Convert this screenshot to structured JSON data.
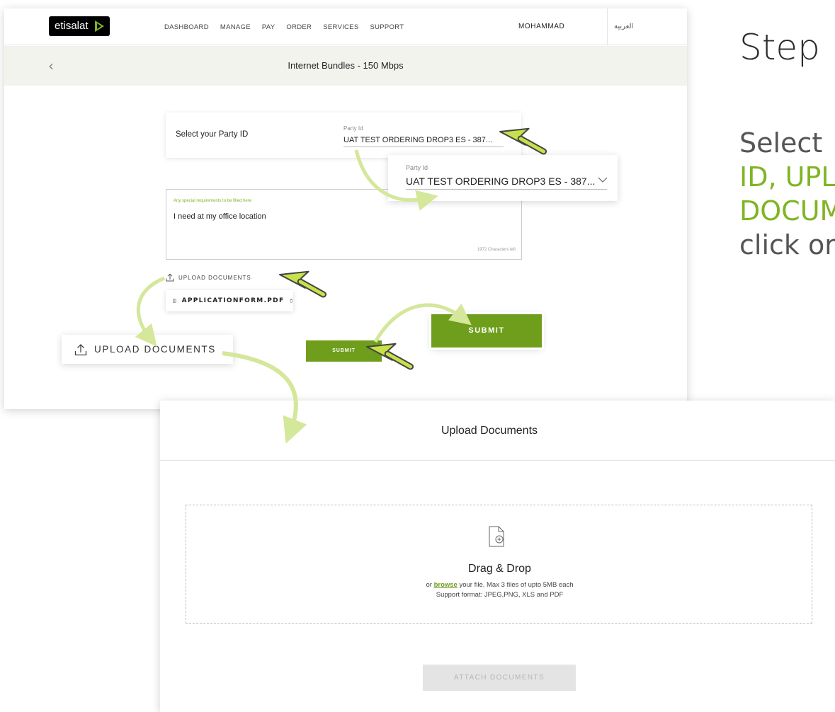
{
  "header": {
    "logo_text": "etisalat",
    "nav": [
      "DASHBOARD",
      "MANAGE",
      "PAY",
      "ORDER",
      "SERVICES",
      "SUPPORT"
    ],
    "user": "MOHAMMAD",
    "language": "العربية"
  },
  "subheader": {
    "back_icon": "chevron-left-icon",
    "title": "Internet Bundles - 150 Mbps"
  },
  "party": {
    "label": "Select your Party ID",
    "field_label": "Party Id",
    "value": "UAT TEST ORDERING DROP3 ES - 387..."
  },
  "requirements": {
    "label": "Any special requirements to be filled here",
    "value": "I need at my office location",
    "counter": "1972 Characters left"
  },
  "upload": {
    "label": "UPLOAD DOCUMENTS",
    "file_name": "APPLICATIONFORM.PDF"
  },
  "submit_label": "SUBMIT",
  "callouts": {
    "party_label": "Party Id",
    "party_value": "UAT TEST ORDERING DROP3 ES - 387...",
    "upload_label": "UPLOAD DOCUMENTS",
    "submit_label": "SUBMIT"
  },
  "step": {
    "title": "Step",
    "line1": "Select",
    "line2": "ID, UPL",
    "line3": "DOCUM",
    "line4": "click or"
  },
  "modal": {
    "title": "Upload Documents",
    "drag_drop": "Drag & Drop",
    "browse_prefix": "or ",
    "browse_link": "browse",
    "browse_suffix": " your file. Max 3 files of upto 5MB each",
    "formats": "Support format: JPEG,PNG, XLS and PDF",
    "attach_button": "ATTACH DOCUMENTS"
  },
  "colors": {
    "accent": "#6e9e1c",
    "accent_light": "#7fb524",
    "arrow_green": "#d4e79a"
  }
}
